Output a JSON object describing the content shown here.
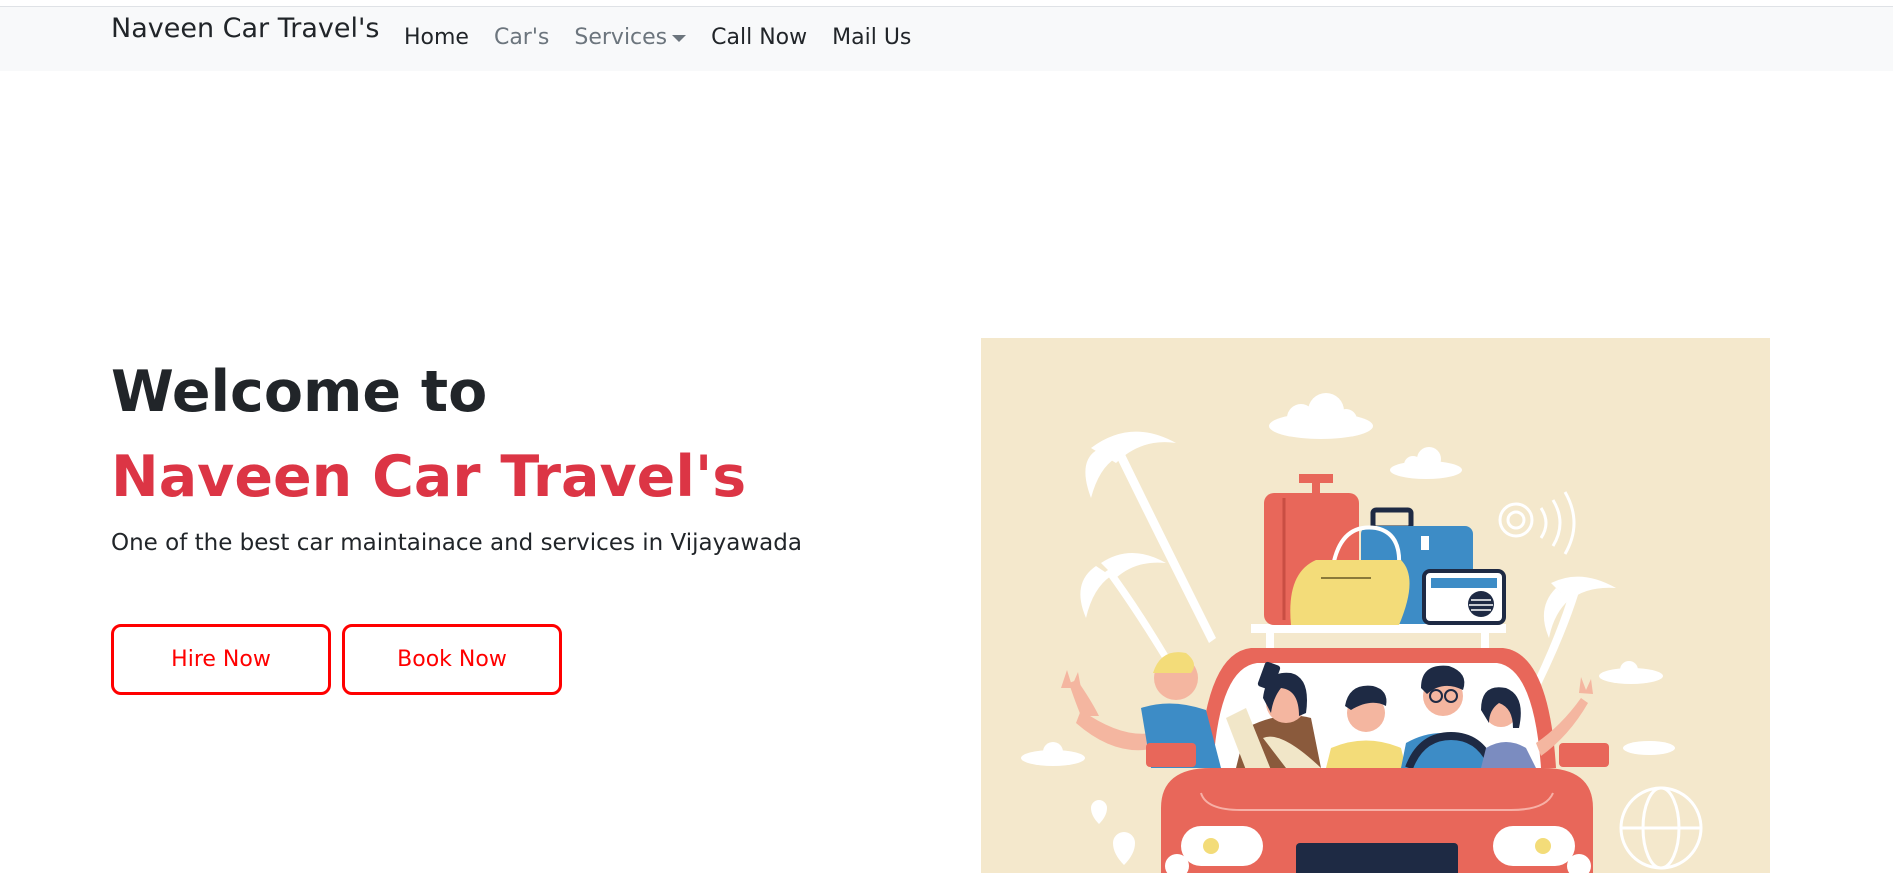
{
  "navbar": {
    "brand": "Naveen Car Travel's",
    "links": [
      {
        "label": "Home",
        "state": "default"
      },
      {
        "label": "Car's",
        "state": "muted"
      },
      {
        "label": "Services",
        "state": "muted",
        "has_dropdown": true
      },
      {
        "label": "Call Now",
        "state": "default"
      },
      {
        "label": "Mail Us",
        "state": "default"
      }
    ]
  },
  "hero": {
    "welcome": "Welcome to",
    "brand": "Naveen Car Travel's",
    "subtitle": "One of the best car maintainace and services in Vijayawada",
    "buttons": {
      "hire": "Hire Now",
      "book": "Book Now"
    }
  },
  "illustration": {
    "description_icon": "car-travel-friends-illustration"
  },
  "colors": {
    "accent_red": "#dc3545",
    "button_red": "#ff0000",
    "navbar_bg": "#f8f9fa",
    "illustration_bg": "#f4e8cc",
    "car_red": "#e8675a"
  }
}
